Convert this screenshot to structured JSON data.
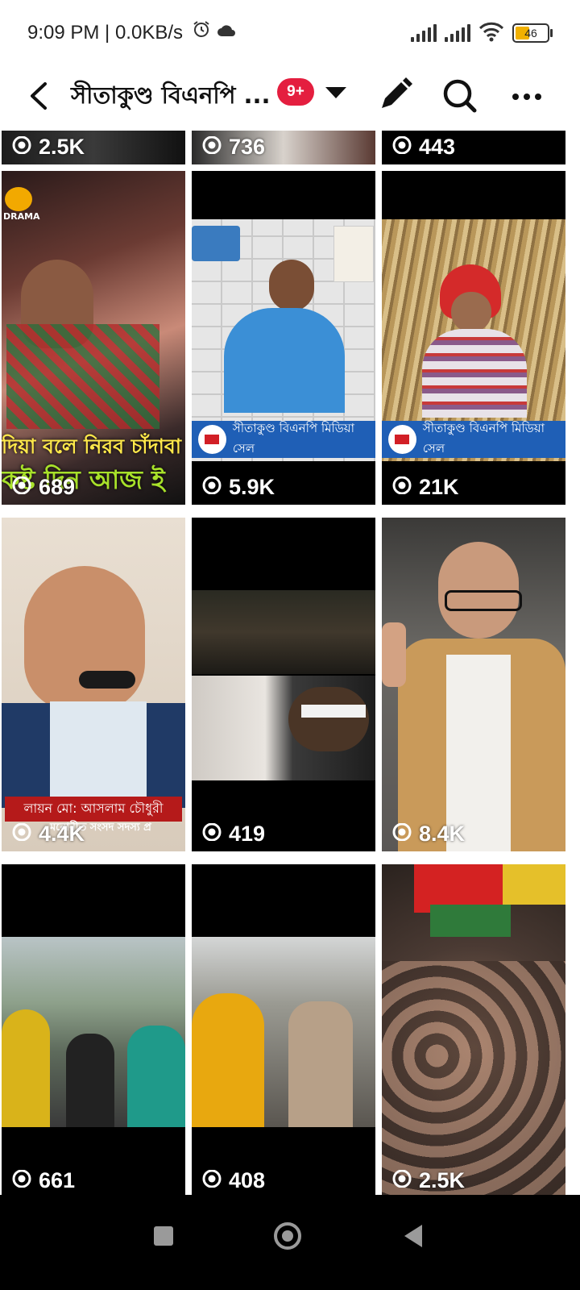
{
  "status_bar": {
    "time": "9:09 PM | 0.0KB/s",
    "battery": "46",
    "battery_level": 0.46
  },
  "header": {
    "title": "সীতাকুণ্ড বিএনপি ...",
    "notification_badge": "9+",
    "icons": [
      "back-arrow-icon",
      "caret-down-icon",
      "pencil-icon",
      "search-icon",
      "more-icon"
    ]
  },
  "grid": {
    "top_row_views": [
      "2.5K",
      "736",
      "443"
    ],
    "tiles": [
      {
        "views": "689",
        "caption_line1": "দিয়া বলে নিরব চাঁদাবা",
        "caption_line2": "কষ্ট দিন আজ ই",
        "logo": "DRAMA"
      },
      {
        "views": "5.9K",
        "banner": "সীতাকুণ্ড বিএনপি মিডিয়া সেল"
      },
      {
        "views": "21K",
        "banner": "সীতাকুণ্ড বিএনপি মিডিয়া সেল"
      },
      {
        "views": "4.4K",
        "nameplate": "লায়ন মো: আসলাম চৌধুরী",
        "subline": "মনোনীত সংসদ সদস্য প্র"
      },
      {
        "views": "419"
      },
      {
        "views": "8.4K"
      },
      {
        "views": "661"
      },
      {
        "views": "408"
      },
      {
        "views": "2.5K"
      }
    ]
  },
  "colors": {
    "accent_red": "#e41e3f",
    "banner_blue": "#1f5fb6",
    "caption_yellow": "#f4e03a"
  }
}
